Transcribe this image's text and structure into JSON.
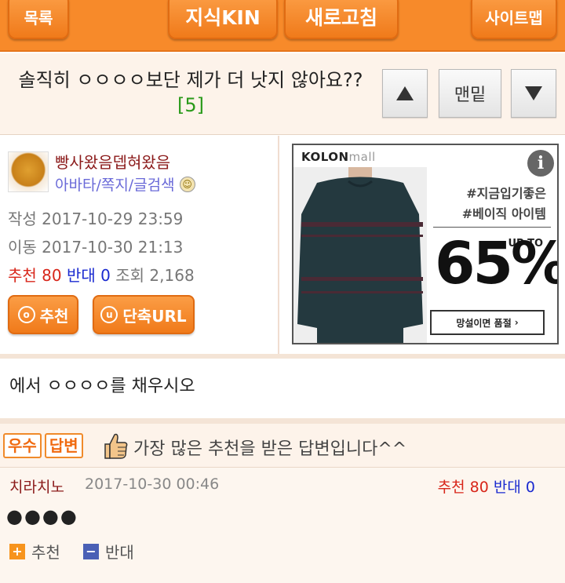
{
  "nav": {
    "list_label": "목록",
    "kin_label": "지식KIN",
    "refresh_label": "새로고침",
    "sitemap_label": "사이트맵"
  },
  "post": {
    "title": "솔직히 ㅇㅇㅇㅇ보단 제가 더 낫지 않아요??",
    "reply_count": "[5]",
    "nav_up_icon": "triangle-up-icon",
    "bottom_label": "맨밑",
    "nav_down_icon": "triangle-down-icon",
    "body": "에서 ㅇㅇㅇㅇ를 채우시오"
  },
  "author": {
    "nickname": "빵사왔음뎁혀왔음",
    "links": "아바타/쪽지/글검색",
    "created": "작성 2017-10-29 23:59",
    "moved": "이동 2017-10-30 21:13",
    "recommend_label": "추천",
    "recommend_count": "80",
    "oppose_label": "반대",
    "oppose_count": "0",
    "views_label": "조회",
    "views_count": "2,168",
    "recommend_button": "추천",
    "shorturl_button": "단축URL"
  },
  "ad": {
    "brand": "KOLON",
    "brand_suffix": "mall",
    "tag1": "#지금입기좋은",
    "tag2": "#베이직 아이템",
    "upto": "UP TO",
    "percent": "65%",
    "cta": "망설이면 품절"
  },
  "best": {
    "badge1": "우수",
    "badge2": "답변",
    "text": "가장 많은 추천을 받은 답변입니다^^"
  },
  "answer": {
    "nickname": "치라치노",
    "date": "2017-10-30 00:46",
    "recommend_label": "추천",
    "recommend_count": "80",
    "oppose_label": "반대",
    "oppose_count": "0",
    "body": "●●●●",
    "action_recommend": "추천",
    "action_oppose": "반대"
  },
  "colors": {
    "accent": "#f78a2a",
    "recommend": "#d8261a",
    "oppose": "#1a2ad0",
    "reply_count": "#2a9a1a"
  }
}
